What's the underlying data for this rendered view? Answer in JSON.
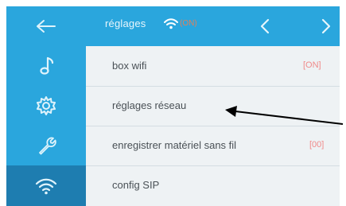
{
  "header": {
    "title": "réglages",
    "status_text": "(ON)",
    "prev_icon": "chevron-left-icon",
    "next_icon": "chevron-right-icon"
  },
  "sidebar": {
    "items": [
      {
        "icon": "back-arrow-icon"
      },
      {
        "icon": "music-note-icon"
      },
      {
        "icon": "gear-icon"
      },
      {
        "icon": "wrench-icon"
      },
      {
        "icon": "wifi-icon",
        "active": true
      }
    ]
  },
  "menu": {
    "rows": [
      {
        "label": "box wifi",
        "value": "[ON]"
      },
      {
        "label": "réglages réseau",
        "value": ""
      },
      {
        "label": "enregistrer matériel sans fil",
        "value": "[00]"
      },
      {
        "label": "config SIP",
        "value": ""
      }
    ]
  },
  "colors": {
    "accent_blue": "#2aa6dd",
    "active_blue": "#1e7db0",
    "status_value": "#f08a8a",
    "annotation_arrow": "#000000"
  }
}
